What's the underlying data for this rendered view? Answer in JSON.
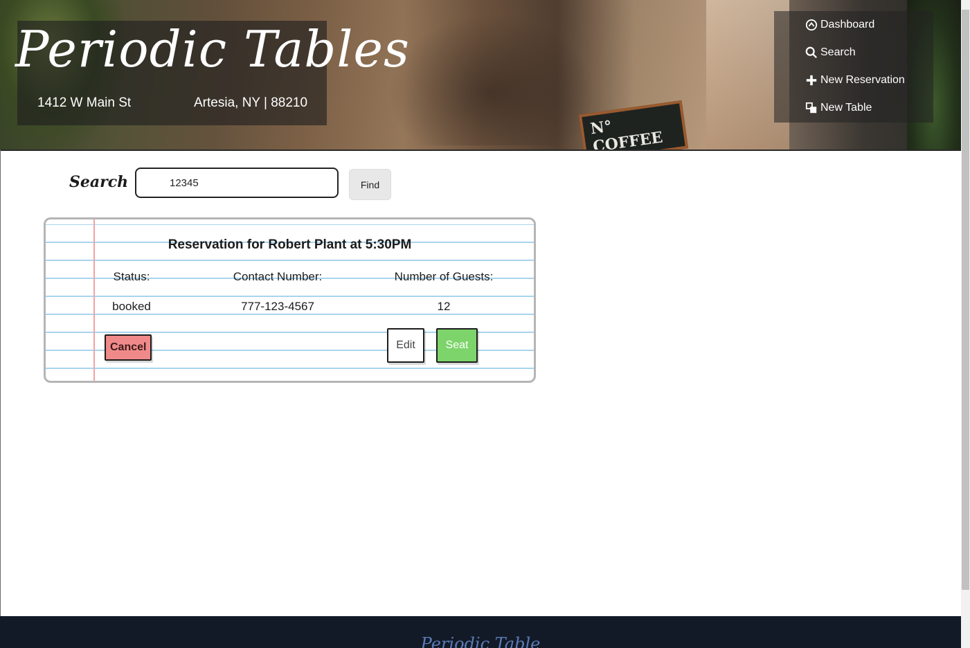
{
  "brand": {
    "title": "Periodic Tables",
    "street": "1412 W Main St",
    "city": "Artesia, NY | 88210"
  },
  "nav": [
    {
      "label": "Dashboard",
      "icon": "dashboard-icon"
    },
    {
      "label": "Search",
      "icon": "search-icon"
    },
    {
      "label": "New Reservation",
      "icon": "plus-icon"
    },
    {
      "label": "New Table",
      "icon": "table-icon"
    }
  ],
  "search": {
    "label": "Search",
    "value": "12345",
    "button": "Find"
  },
  "reservation": {
    "title": "Reservation for Robert Plant at 5:30PM",
    "status_label": "Status:",
    "status": "booked",
    "contact_label": "Contact Number:",
    "contact": "777-123-4567",
    "guests_label": "Number of Guests:",
    "guests": "12",
    "cancel": "Cancel",
    "edit": "Edit",
    "seat": "Seat"
  },
  "footer": {
    "brand": "Periodic Table"
  },
  "colors": {
    "cancel": "#f08a8a",
    "seat": "#7dd46a",
    "footer": "#131a27",
    "paper_line": "#a9d4ee",
    "margin_line": "#f2a3a3"
  }
}
